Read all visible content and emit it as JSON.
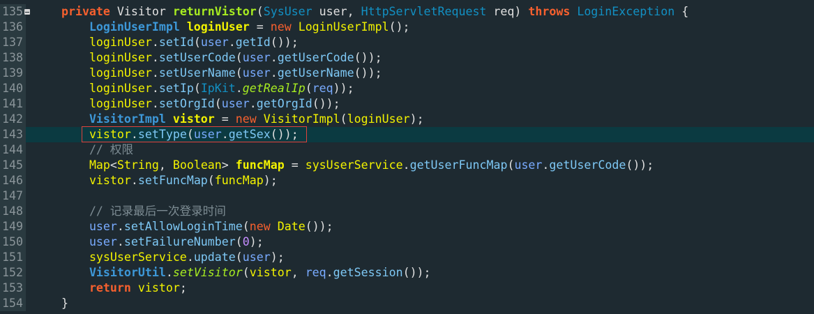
{
  "editor": {
    "gutter_numbers": [
      "135",
      "136",
      "137",
      "138",
      "139",
      "140",
      "141",
      "142",
      "143",
      "144",
      "145",
      "146",
      "147",
      "148",
      "149",
      "150",
      "151",
      "152",
      "153",
      "154"
    ],
    "lines": [
      {
        "n": "135",
        "tokens": [
          [
            "    ",
            ""
          ],
          [
            "private",
            "kw"
          ],
          [
            " Visitor ",
            "plain"
          ],
          [
            "returnVistor",
            "mthb"
          ],
          [
            "(",
            "plain"
          ],
          [
            "SysUser",
            "type"
          ],
          [
            " user, ",
            "plain"
          ],
          [
            "HttpServletRequest",
            "type"
          ],
          [
            " req) ",
            "plain"
          ],
          [
            "throws",
            "kw"
          ],
          [
            " ",
            "plain"
          ],
          [
            "LoginException",
            "type"
          ],
          [
            " {",
            "plain"
          ]
        ]
      },
      {
        "n": "136",
        "tokens": [
          [
            "        ",
            ""
          ],
          [
            "LoginUserImpl",
            "typeb"
          ],
          [
            " ",
            "plain"
          ],
          [
            "loginUser",
            "varb"
          ],
          [
            " = ",
            "plain"
          ],
          [
            "new",
            "kw2"
          ],
          [
            " ",
            "plain"
          ],
          [
            "LoginUserImpl",
            "var"
          ],
          [
            "();",
            "plain"
          ]
        ]
      },
      {
        "n": "137",
        "tokens": [
          [
            "        ",
            ""
          ],
          [
            "loginUser",
            "var"
          ],
          [
            ".",
            "plain"
          ],
          [
            "setId",
            "mth"
          ],
          [
            "(",
            "plain"
          ],
          [
            "user",
            "param"
          ],
          [
            ".",
            "plain"
          ],
          [
            "getId",
            "mth"
          ],
          [
            "());",
            "plain"
          ]
        ]
      },
      {
        "n": "138",
        "tokens": [
          [
            "        ",
            ""
          ],
          [
            "loginUser",
            "var"
          ],
          [
            ".",
            "plain"
          ],
          [
            "setUserCode",
            "mth"
          ],
          [
            "(",
            "plain"
          ],
          [
            "user",
            "param"
          ],
          [
            ".",
            "plain"
          ],
          [
            "getUserCode",
            "mth"
          ],
          [
            "());",
            "plain"
          ]
        ]
      },
      {
        "n": "139",
        "tokens": [
          [
            "        ",
            ""
          ],
          [
            "loginUser",
            "var"
          ],
          [
            ".",
            "plain"
          ],
          [
            "setUserName",
            "mth"
          ],
          [
            "(",
            "plain"
          ],
          [
            "user",
            "param"
          ],
          [
            ".",
            "plain"
          ],
          [
            "getUserName",
            "mth"
          ],
          [
            "());",
            "plain"
          ]
        ]
      },
      {
        "n": "140",
        "tokens": [
          [
            "        ",
            ""
          ],
          [
            "loginUser",
            "var"
          ],
          [
            ".",
            "plain"
          ],
          [
            "setIp",
            "mth"
          ],
          [
            "(",
            "plain"
          ],
          [
            "IpKit",
            "type"
          ],
          [
            ".",
            "plain"
          ],
          [
            "getRealIp",
            "ital"
          ],
          [
            "(",
            "plain"
          ],
          [
            "req",
            "param"
          ],
          [
            "));",
            "plain"
          ]
        ]
      },
      {
        "n": "141",
        "tokens": [
          [
            "        ",
            ""
          ],
          [
            "loginUser",
            "var"
          ],
          [
            ".",
            "plain"
          ],
          [
            "setOrgId",
            "mth"
          ],
          [
            "(",
            "plain"
          ],
          [
            "user",
            "param"
          ],
          [
            ".",
            "plain"
          ],
          [
            "getOrgId",
            "mth"
          ],
          [
            "());",
            "plain"
          ]
        ]
      },
      {
        "n": "142",
        "tokens": [
          [
            "        ",
            ""
          ],
          [
            "VisitorImpl",
            "typeb"
          ],
          [
            " ",
            "plain"
          ],
          [
            "vistor",
            "varb"
          ],
          [
            " = ",
            "plain"
          ],
          [
            "new",
            "kw2"
          ],
          [
            " ",
            "plain"
          ],
          [
            "VisitorImpl",
            "var"
          ],
          [
            "(",
            "plain"
          ],
          [
            "loginUser",
            "var"
          ],
          [
            ");",
            "plain"
          ]
        ]
      },
      {
        "n": "143",
        "tokens": [
          [
            "        ",
            ""
          ],
          [
            "vistor",
            "var"
          ],
          [
            ".",
            "plain"
          ],
          [
            "setType",
            "mth"
          ],
          [
            "(",
            "plain"
          ],
          [
            "user",
            "param"
          ],
          [
            ".",
            "plain"
          ],
          [
            "getSex",
            "mth"
          ],
          [
            "());",
            "plain"
          ]
        ]
      },
      {
        "n": "144",
        "tokens": [
          [
            "        ",
            ""
          ],
          [
            "// 权限",
            "cmt"
          ]
        ]
      },
      {
        "n": "145",
        "tokens": [
          [
            "        ",
            ""
          ],
          [
            "Map",
            "var"
          ],
          [
            "<",
            "plain"
          ],
          [
            "String",
            "var"
          ],
          [
            ", ",
            "plain"
          ],
          [
            "Boolean",
            "var"
          ],
          [
            "> ",
            "plain"
          ],
          [
            "funcMap",
            "varb"
          ],
          [
            " = ",
            "plain"
          ],
          [
            "sysUserService",
            "var"
          ],
          [
            ".",
            "plain"
          ],
          [
            "getUserFuncMap",
            "mth"
          ],
          [
            "(",
            "plain"
          ],
          [
            "user",
            "param"
          ],
          [
            ".",
            "plain"
          ],
          [
            "getUserCode",
            "mth"
          ],
          [
            "());",
            "plain"
          ]
        ]
      },
      {
        "n": "146",
        "tokens": [
          [
            "        ",
            ""
          ],
          [
            "vistor",
            "var"
          ],
          [
            ".",
            "plain"
          ],
          [
            "setFuncMap",
            "mth"
          ],
          [
            "(",
            "plain"
          ],
          [
            "funcMap",
            "var"
          ],
          [
            ");",
            "plain"
          ]
        ]
      },
      {
        "n": "147",
        "tokens": []
      },
      {
        "n": "148",
        "tokens": [
          [
            "        ",
            ""
          ],
          [
            "// 记录最后一次登录时间",
            "cmt"
          ]
        ]
      },
      {
        "n": "149",
        "tokens": [
          [
            "        ",
            ""
          ],
          [
            "user",
            "param"
          ],
          [
            ".",
            "plain"
          ],
          [
            "setAllowLoginTime",
            "mth"
          ],
          [
            "(",
            "plain"
          ],
          [
            "new",
            "kw2"
          ],
          [
            " ",
            "plain"
          ],
          [
            "Date",
            "var"
          ],
          [
            "());",
            "plain"
          ]
        ]
      },
      {
        "n": "150",
        "tokens": [
          [
            "        ",
            ""
          ],
          [
            "user",
            "param"
          ],
          [
            ".",
            "plain"
          ],
          [
            "setFailureNumber",
            "mth"
          ],
          [
            "(",
            "plain"
          ],
          [
            "0",
            "num"
          ],
          [
            ");",
            "plain"
          ]
        ]
      },
      {
        "n": "151",
        "tokens": [
          [
            "        ",
            ""
          ],
          [
            "sysUserService",
            "var"
          ],
          [
            ".",
            "plain"
          ],
          [
            "update",
            "mth"
          ],
          [
            "(",
            "plain"
          ],
          [
            "user",
            "param"
          ],
          [
            ");",
            "plain"
          ]
        ]
      },
      {
        "n": "152",
        "tokens": [
          [
            "        ",
            ""
          ],
          [
            "VisitorUtil",
            "typeb"
          ],
          [
            ".",
            "plain"
          ],
          [
            "setVisitor",
            "ital"
          ],
          [
            "(",
            "plain"
          ],
          [
            "vistor",
            "var"
          ],
          [
            ", ",
            "plain"
          ],
          [
            "req",
            "param"
          ],
          [
            ".",
            "plain"
          ],
          [
            "getSession",
            "mth"
          ],
          [
            "());",
            "plain"
          ]
        ]
      },
      {
        "n": "153",
        "tokens": [
          [
            "        ",
            ""
          ],
          [
            "return",
            "kw"
          ],
          [
            " ",
            "plain"
          ],
          [
            "vistor",
            "var"
          ],
          [
            ";",
            "plain"
          ]
        ]
      },
      {
        "n": "154",
        "tokens": [
          [
            "    ",
            ""
          ],
          [
            "}",
            "plain"
          ]
        ]
      }
    ],
    "current_line": "143",
    "colors": {
      "background": "#1e2a31",
      "current_line": "#0b3a41",
      "gutter": "#2a3a40",
      "highlight_box": "#e0423c"
    }
  }
}
